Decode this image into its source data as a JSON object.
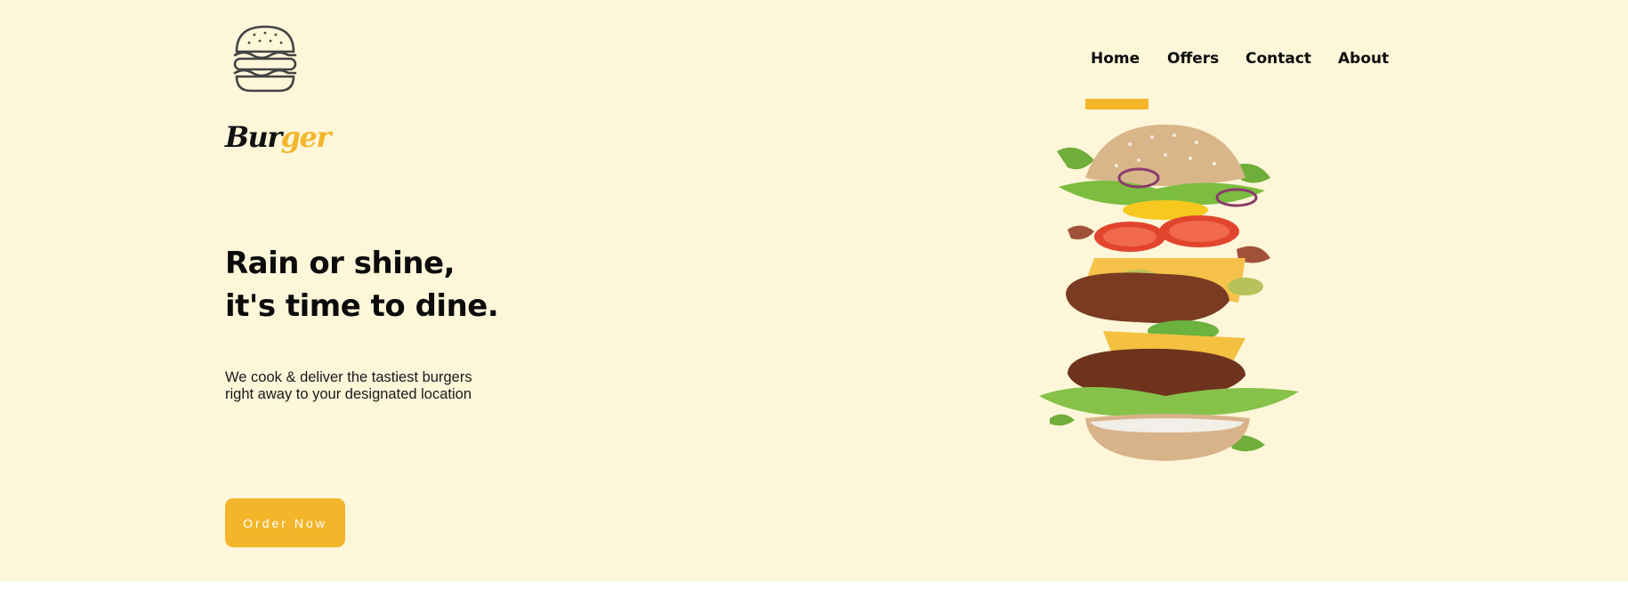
{
  "brand": {
    "part1": "Bur",
    "part2": "ger"
  },
  "colors": {
    "accent": "#f3b62b",
    "background": "#fdf6d9",
    "text": "#0b0b0b"
  },
  "icons": {
    "logo": "burger-outline-icon"
  },
  "nav": {
    "items": [
      {
        "label": "Home",
        "active": true
      },
      {
        "label": "Offers",
        "active": false
      },
      {
        "label": "Contact",
        "active": false
      },
      {
        "label": "About",
        "active": false
      }
    ]
  },
  "hero": {
    "headline": [
      "Rain or shine,",
      "it's time to dine."
    ],
    "description": [
      "We cook & deliver the tastiest burgers",
      "right away to your designated location"
    ],
    "cta_label": "Order Now"
  }
}
